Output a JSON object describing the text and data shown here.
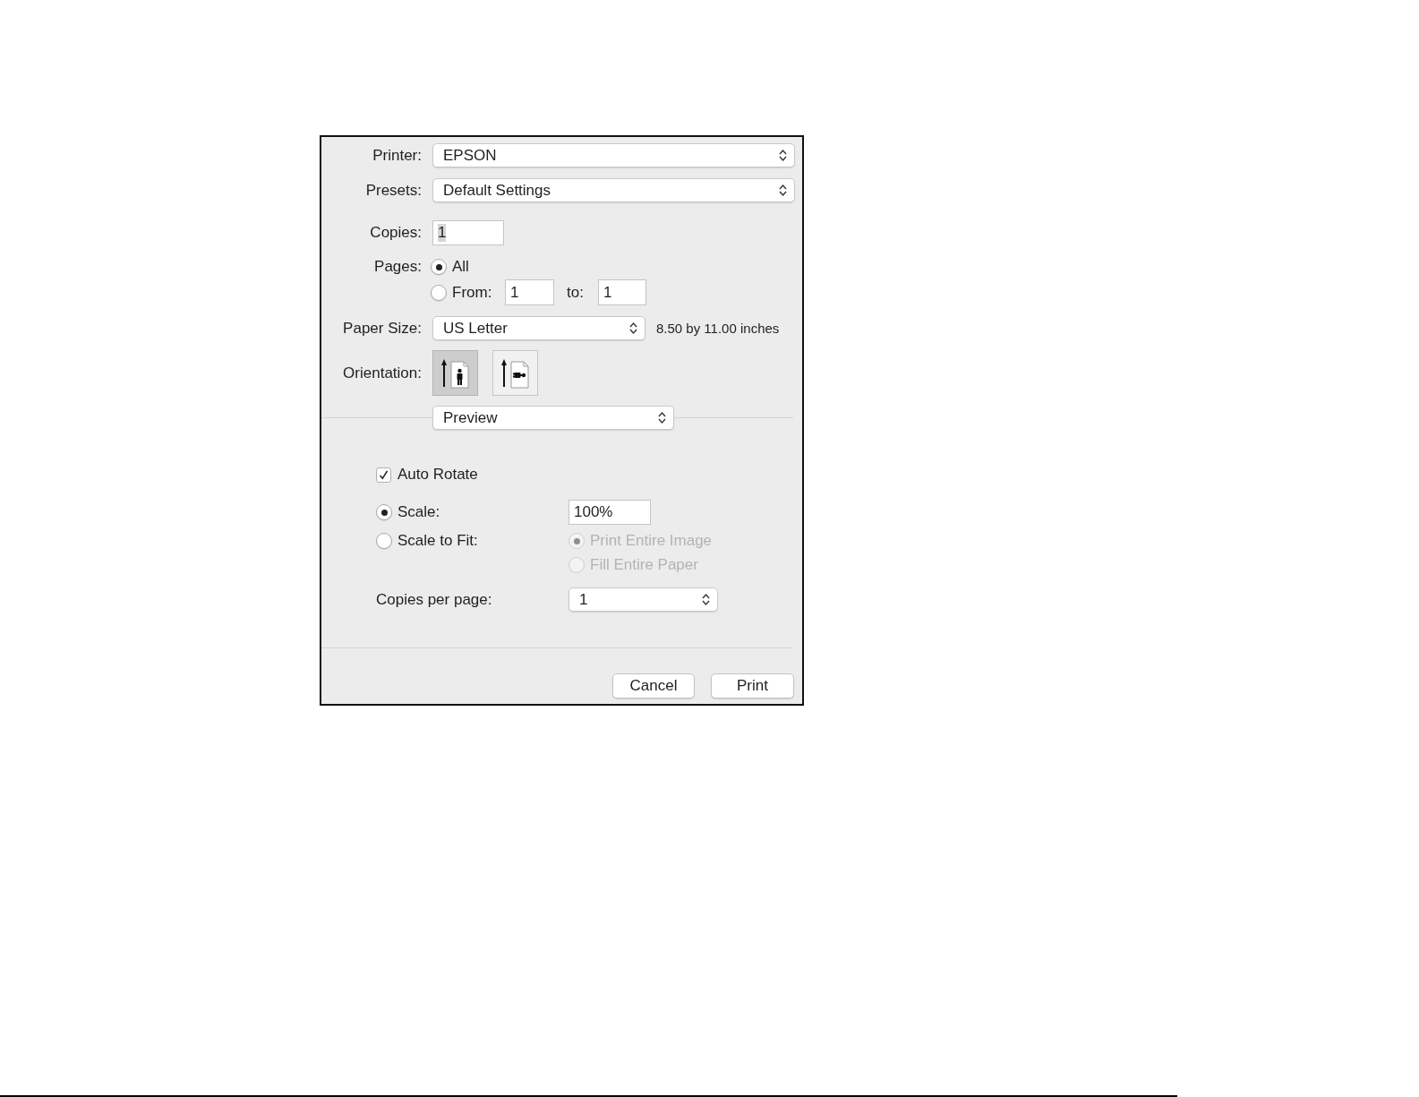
{
  "printer": {
    "label": "Printer:",
    "value": "EPSON"
  },
  "presets": {
    "label": "Presets:",
    "value": "Default Settings"
  },
  "copies": {
    "label": "Copies:",
    "value": "1",
    "value_selected": true
  },
  "pages": {
    "label": "Pages:",
    "options": [
      {
        "label": "All",
        "selected": true
      },
      {
        "label": "From:",
        "selected": false,
        "from": "1",
        "to_label": "to:",
        "to": "1"
      }
    ]
  },
  "paper_size": {
    "label": "Paper Size:",
    "value": "US Letter",
    "dimensions": "8.50 by 11.00 inches"
  },
  "orientation": {
    "label": "Orientation:",
    "options": [
      {
        "kind": "portrait",
        "selected": true
      },
      {
        "kind": "landscape",
        "selected": false
      }
    ]
  },
  "section_menu": {
    "value": "Preview"
  },
  "preview": {
    "auto_rotate": {
      "label": "Auto Rotate",
      "checked": true
    },
    "scale_modes": [
      {
        "label": "Scale:",
        "selected": true,
        "value": "100%"
      },
      {
        "label": "Scale to Fit:",
        "selected": false
      }
    ],
    "fit_options": [
      {
        "label": "Print Entire Image",
        "selected": true,
        "disabled": true
      },
      {
        "label": "Fill Entire Paper",
        "selected": false,
        "disabled": true
      }
    ],
    "copies_per_page": {
      "label": "Copies per page:",
      "value": "1"
    }
  },
  "buttons": [
    {
      "label": "Cancel"
    },
    {
      "label": "Print"
    }
  ]
}
